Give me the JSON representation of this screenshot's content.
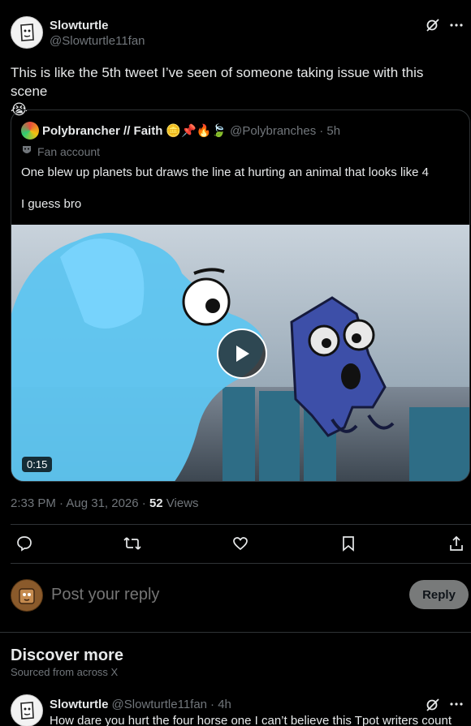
{
  "tweet": {
    "author_name": "Slowturtle",
    "author_handle": "@Slowturtle11fan",
    "text": "This is like the 5th tweet I’ve seen of someone taking issue with this scene",
    "text_emoji": "😭",
    "timestamp": "2:33 PM · Aug 31, 2026 · ",
    "views_count": "52",
    "views_label": " Views"
  },
  "quote": {
    "author_name": "Polybrancher // Faith",
    "name_emojis": "🪙📌🔥🍃",
    "author_handle": "@Polybranches",
    "time": "· 5h",
    "account_label": "Fan account",
    "text_line1": "One blew up planets but draws the line at hurting an animal that looks like 4",
    "text_line2": "I guess bro",
    "video_duration": "0:15"
  },
  "reply": {
    "placeholder": "Post your reply",
    "button_label": "Reply"
  },
  "discover": {
    "title": "Discover more",
    "subtitle": "Sourced from across X"
  },
  "next_post": {
    "author_name": "Slowturtle",
    "author_handle": "@Slowturtle11fan",
    "time": "· 4h",
    "text": "How dare you hurt the four horse one I can’t believe this Tpot writers count"
  },
  "icons": [
    "grok-icon",
    "more-icon",
    "reply-icon",
    "retweet-icon",
    "like-icon",
    "bookmark-icon",
    "share-icon",
    "play-icon"
  ],
  "colors": {
    "background": "#000000",
    "text": "#e7e9ea",
    "muted": "#71767b",
    "border": "#2f3336",
    "reply_button": "#787a7a"
  }
}
